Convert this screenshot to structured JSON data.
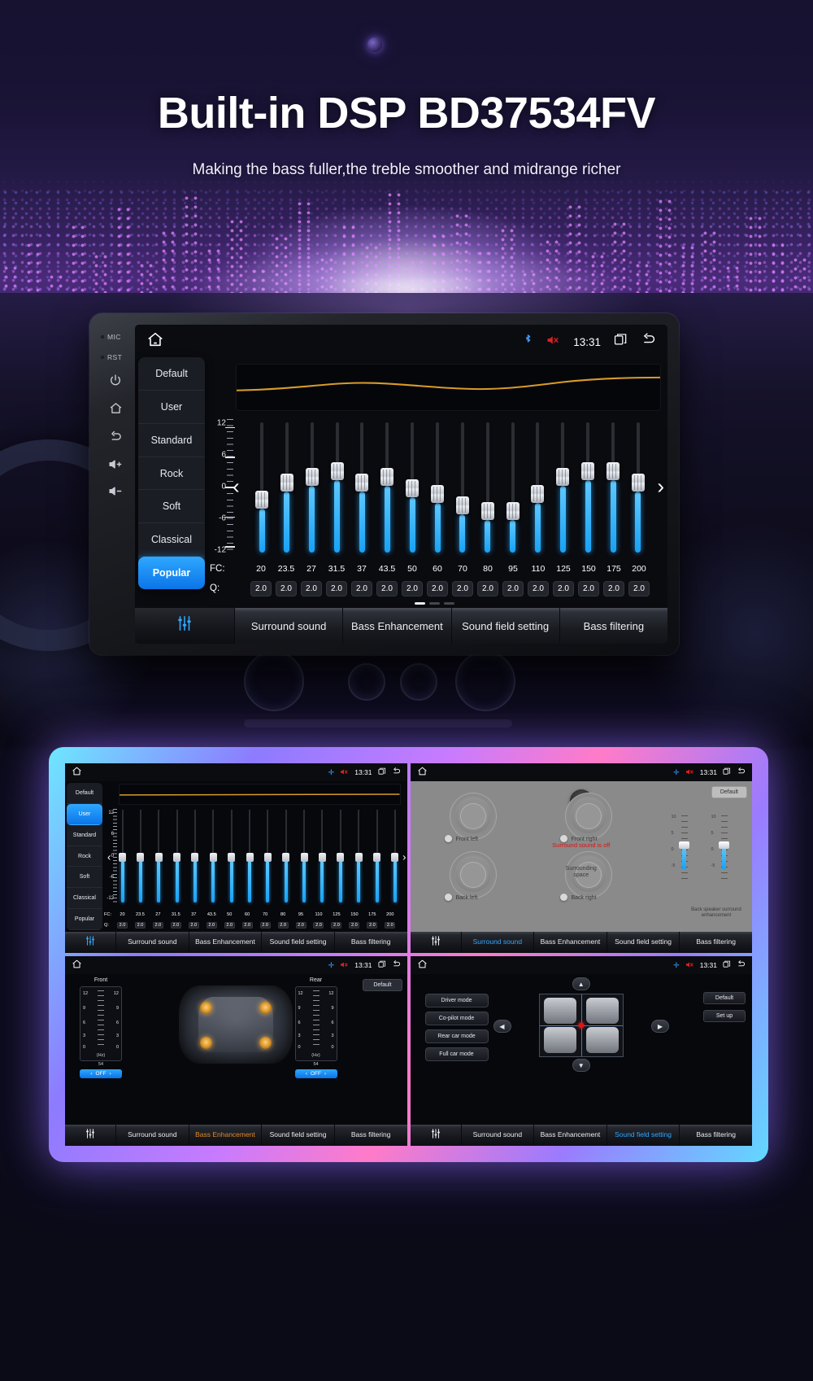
{
  "hero": {
    "title": "Built-in DSP BD37534FV",
    "subtitle": "Making the bass fuller,the treble smoother and midrange richer"
  },
  "device": {
    "side_rail": {
      "mic_label": "MIC",
      "rst_label": "RST",
      "icons": [
        "power-icon",
        "home-icon",
        "back-icon",
        "volume-up-icon",
        "volume-down-icon"
      ],
      "volume_up": "+",
      "volume_down": "−"
    },
    "statusbar": {
      "home_icon": "home-icon",
      "bluetooth_icon": "bluetooth-icon",
      "mute_icon": "speaker-mute-icon",
      "time": "13:31",
      "recents_icon": "recents-icon",
      "back_icon": "back-arrow-icon"
    }
  },
  "equalizer": {
    "presets": [
      "Default",
      "User",
      "Standard",
      "Rock",
      "Soft",
      "Classical",
      "Popular"
    ],
    "active_preset": "Popular",
    "axis_labels": [
      "12",
      "6",
      "0",
      "-6",
      "-12"
    ],
    "axis_range": [
      -12,
      12
    ],
    "fc_label": "FC:",
    "q_label": "Q:",
    "bands": [
      {
        "fc": "20",
        "q": "2.0",
        "gain": -2
      },
      {
        "fc": "23.5",
        "q": "2.0",
        "gain": 1
      },
      {
        "fc": "27",
        "q": "2.0",
        "gain": 2
      },
      {
        "fc": "31.5",
        "q": "2.0",
        "gain": 3
      },
      {
        "fc": "37",
        "q": "2.0",
        "gain": 1
      },
      {
        "fc": "43.5",
        "q": "2.0",
        "gain": 2
      },
      {
        "fc": "50",
        "q": "2.0",
        "gain": 0
      },
      {
        "fc": "60",
        "q": "2.0",
        "gain": -1
      },
      {
        "fc": "70",
        "q": "2.0",
        "gain": -3
      },
      {
        "fc": "80",
        "q": "2.0",
        "gain": -4
      },
      {
        "fc": "95",
        "q": "2.0",
        "gain": -4
      },
      {
        "fc": "110",
        "q": "2.0",
        "gain": -1
      },
      {
        "fc": "125",
        "q": "2.0",
        "gain": 2
      },
      {
        "fc": "150",
        "q": "2.0",
        "gain": 3
      },
      {
        "fc": "175",
        "q": "2.0",
        "gain": 3
      },
      {
        "fc": "200",
        "q": "2.0",
        "gain": 1
      }
    ],
    "prev_arrow": "‹",
    "next_arrow": "›",
    "page_count": 3,
    "page_active": 1
  },
  "tabs": {
    "eq_icon": "equalizer-sliders-icon",
    "items": [
      "Surround sound",
      "Bass Enhancement",
      "Sound field setting",
      "Bass filtering"
    ]
  },
  "thumbs": {
    "eq": {
      "active_preset": "User",
      "tab_active": "equalizer"
    },
    "surround": {
      "power_icon": "power-icon",
      "default_button": "Default",
      "status_text": "Surround sound is off",
      "labels": {
        "front_left": "Front left",
        "front_right": "Front right",
        "back_left": "Back left",
        "back_right": "Back right",
        "surrounding_space": "Surrounding space",
        "back_speaker": "Back speaker surround enhancement"
      },
      "fader_scale": [
        "10",
        "5",
        "0",
        "-5",
        "-10"
      ],
      "tab_active": "Surround sound"
    },
    "bass": {
      "front_label": "Front",
      "rear_label": "Rear",
      "default_button": "Default",
      "scale": [
        "12",
        "9",
        "6",
        "3",
        "0"
      ],
      "unit": "(Hz)",
      "value": "54",
      "range": "20 ~ 200",
      "off_label": "OFF",
      "tab_active": "Bass Enhancement"
    },
    "field": {
      "modes": [
        "Driver mode",
        "Co-pilot mode",
        "Rear car mode",
        "Full car mode"
      ],
      "default_button": "Default",
      "setup_button": "Set up",
      "tab_active": "Sound field setting"
    }
  }
}
